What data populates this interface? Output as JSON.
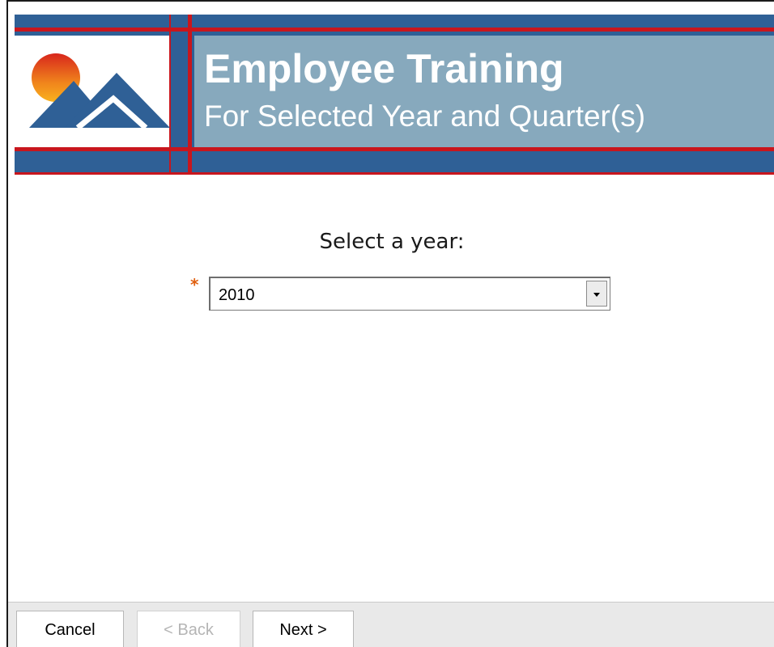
{
  "header": {
    "title": "Employee Training",
    "subtitle": "For Selected Year and Quarter(s)",
    "colors": {
      "band_blue": "#2f6096",
      "title_area": "#87a9bd",
      "stripe_red": "#c8161d",
      "sun_orange": "#f0841c",
      "mountain_blue": "#2f6096"
    },
    "logo_icon": "sun-mountain-logo"
  },
  "form": {
    "prompt": "Select a year:",
    "required_marker": "*",
    "year_select": {
      "selected": "2010",
      "icon": "dropdown-arrow-icon"
    }
  },
  "footer": {
    "cancel_label": "Cancel",
    "back_label": "< Back",
    "next_label": "Next >",
    "back_enabled": false
  }
}
